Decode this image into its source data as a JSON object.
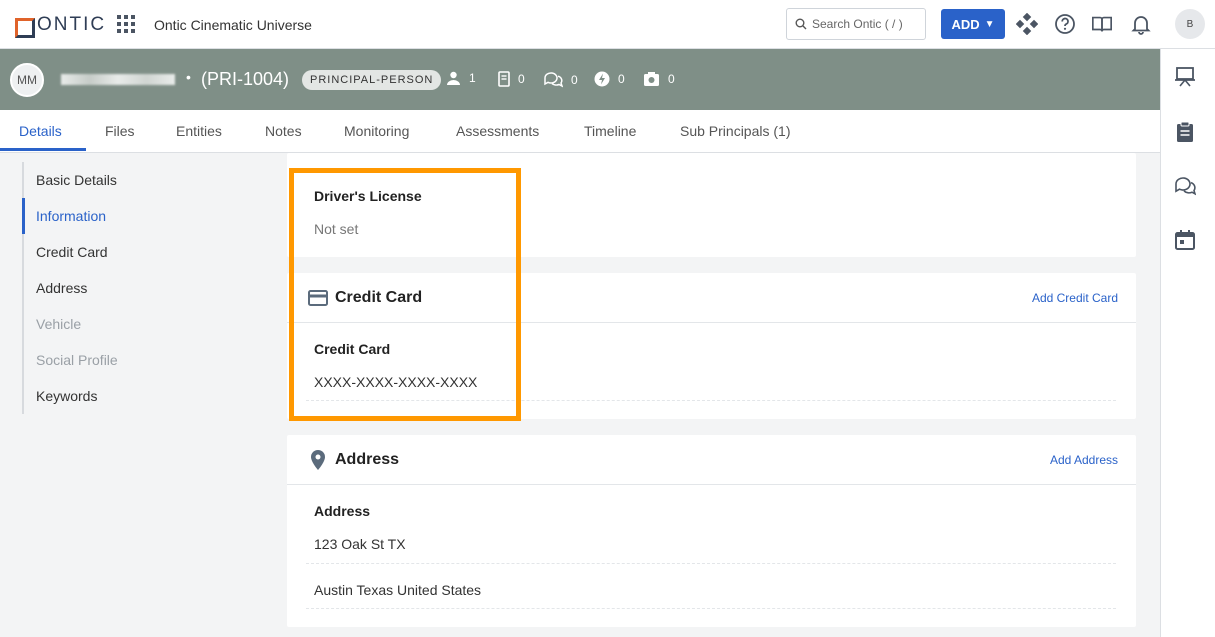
{
  "topbar": {
    "logo_text": "ONTIC",
    "org_name": "Ontic Cinematic Universe",
    "search_placeholder": "Search Ontic ( / )",
    "add_label": "ADD",
    "avatar_initial": "B"
  },
  "principal": {
    "initials": "MM",
    "separator": "•",
    "id": "(PRI-1004)",
    "role": "PRINCIPAL-PERSON",
    "stats": {
      "people": "1",
      "documents": "0",
      "comments": "0",
      "alerts": "0",
      "photos": "0"
    }
  },
  "tabs": [
    "Details",
    "Files",
    "Entities",
    "Notes",
    "Monitoring",
    "Assessments",
    "Timeline",
    "Sub Principals (1)"
  ],
  "leftnav": [
    "Basic Details",
    "Information",
    "Credit Card",
    "Address",
    "Vehicle",
    "Social Profile",
    "Keywords"
  ],
  "drivers_license": {
    "label": "Driver's License",
    "value": "Not set"
  },
  "credit_card": {
    "title": "Credit Card",
    "add_link": "Add Credit Card",
    "field_label": "Credit Card",
    "field_value": "XXXX-XXXX-XXXX-XXXX"
  },
  "address": {
    "title": "Address",
    "add_link": "Add Address",
    "field_label": "Address",
    "line1": "123 Oak St TX",
    "line2": "Austin Texas United States"
  },
  "colors": {
    "accent": "#2a62c9",
    "header_bg": "#7f8f87",
    "highlight": "#ff9800"
  }
}
